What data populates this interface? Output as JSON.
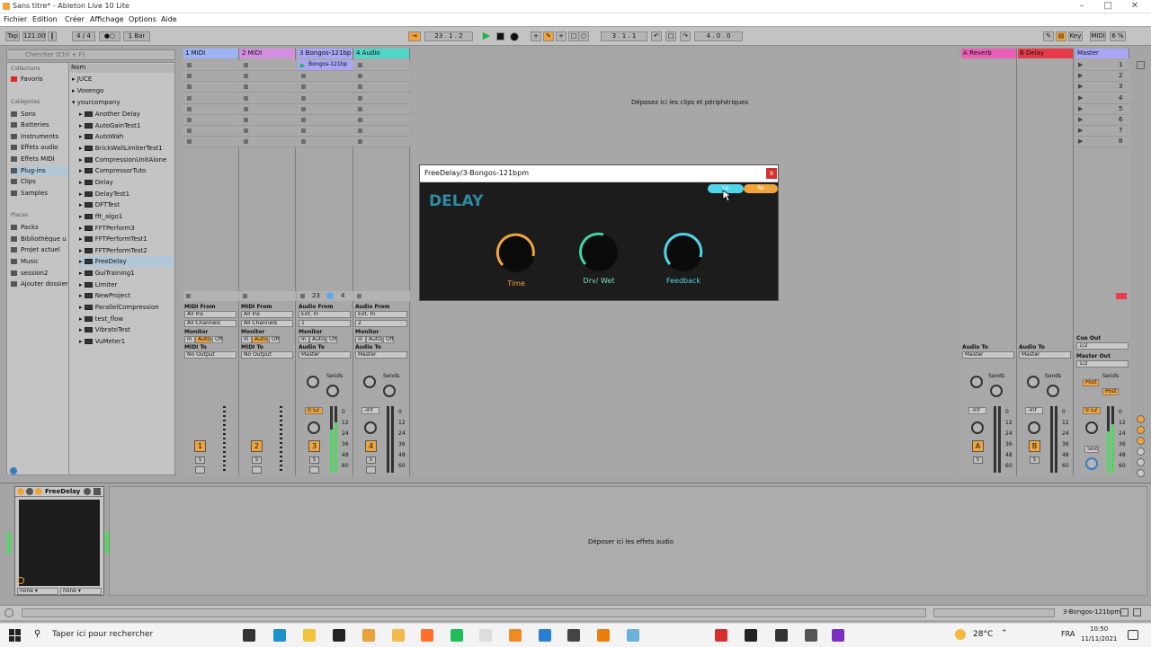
{
  "app": {
    "title": "Sans titre* - Ableton Live 10 Lite"
  },
  "menu": [
    "Fichier",
    "Edition",
    "Créer",
    "Affichage",
    "Options",
    "Aide"
  ],
  "control": {
    "tap": "Tap",
    "tempo": "121.00",
    "sig": "4 / 4",
    "quant": "1 Bar",
    "pos": "23 .  1 .  2",
    "pos2": "3 .  1 .  1",
    "len": "4 .  0 .  0",
    "key": "Key",
    "midi": "MIDI",
    "cpu": "6 %"
  },
  "browser": {
    "search_placeholder": "Chercher (Ctrl + F)",
    "collections_header": "Collections",
    "favoris": "Favoris",
    "categories_header": "Catégories",
    "categories": [
      "Sons",
      "Batteries",
      "Instruments",
      "Effets audio",
      "Effets MIDI",
      "Plug-ins",
      "Clips",
      "Samples"
    ],
    "places_header": "Places",
    "places": [
      "Packs",
      "Bibliothèque u",
      "Projet actuel",
      "Music",
      "session2",
      "Ajouter dossier"
    ],
    "nom_header": "Nom",
    "folders": [
      "JUCE",
      "Voxengo",
      "yourcompany"
    ],
    "files": [
      "Another Delay",
      "AutoGainTest1",
      "AutoWah",
      "BrickWallLimiterTest1",
      "CompressionUnitAlone",
      "CompressorTuto",
      "Delay",
      "DelayTest1",
      "DFTTest",
      "fft_algo1",
      "FFTPerform3",
      "FFTPerformTest1",
      "FFTPerformTest2",
      "FreeDelay",
      "GuiTraining1",
      "Limiter",
      "NewProject",
      "ParallelCompression",
      "test_flow",
      "VibratoTest",
      "VuMeter1"
    ]
  },
  "tracks": [
    {
      "name": "1 MIDI",
      "color": "#9eb3f5",
      "num": "1",
      "from": "MIDI From",
      "in": "All Ins",
      "ch": "All Channels",
      "to": "MIDI To",
      "out": "No Output"
    },
    {
      "name": "2 MIDI",
      "color": "#d48ee0",
      "num": "2",
      "from": "MIDI From",
      "in": "All Ins",
      "ch": "All Channels",
      "to": "MIDI To",
      "out": "No Output"
    },
    {
      "name": "3 Bongos-121bp",
      "color": "#a9a6f5",
      "num": "3",
      "from": "Audio From",
      "in": "Ext. In",
      "ch": "1",
      "to": "Audio To",
      "out": "Master",
      "vol": "0.52"
    },
    {
      "name": "4 Audio",
      "color": "#4fd6c9",
      "num": "4",
      "from": "Audio From",
      "in": "Ext. In",
      "ch": "2",
      "to": "Audio To",
      "out": "Master",
      "vol": "-Inf"
    }
  ],
  "clip3": "Bongos-121bp",
  "monitor": {
    "label": "Monitor",
    "in": "In",
    "auto": "Auto",
    "off": "Off"
  },
  "sends": "Sends",
  "drop_clips": "Déposez ici les clips et périphériques",
  "returns": [
    {
      "name": "A Reverb",
      "color": "#e85fb5",
      "num": "A",
      "to": "Audio To",
      "out": "Master",
      "vol": "-Inf"
    },
    {
      "name": "B Delay",
      "color": "#e83c4a",
      "num": "B",
      "to": "Audio To",
      "out": "Master",
      "vol": "-Inf"
    }
  ],
  "master": {
    "name": "Master",
    "scenes": [
      "1",
      "2",
      "3",
      "4",
      "5",
      "6",
      "7",
      "8"
    ],
    "cue": "Cue Out",
    "cue_val": "1/2",
    "mout": "Master Out",
    "mout_val": "1/2",
    "vol": "0.52",
    "post": "Post",
    "solo": "Solo"
  },
  "meter_ticks": [
    "0",
    "12",
    "24",
    "36",
    "48",
    "60"
  ],
  "stop_row": {
    "t3a": "23",
    "t3b": "4"
  },
  "plugin": {
    "title": "FreeDelay/3-Bongos-121bpm",
    "close": "x",
    "name": "DELAY",
    "btn1": "Lo",
    "btn2": "Re",
    "knobs": [
      "Time",
      "Drv/ Wet",
      "Feedback"
    ]
  },
  "device": {
    "name": "FreeDelay",
    "sel1": "none",
    "sel2": "none",
    "drop": "Déposer ici les effets audio"
  },
  "status": {
    "clip": "3-Bongos-121bpm"
  },
  "taskbar": {
    "search": "Taper ici pour rechercher",
    "weather": "28°C",
    "lang": "FRA",
    "time": "10:50",
    "date": "11/11/2021"
  }
}
